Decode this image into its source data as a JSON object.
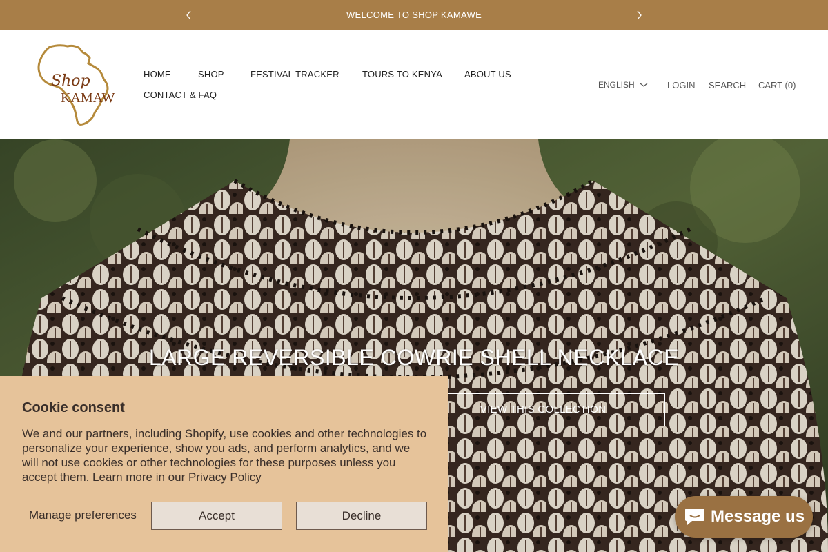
{
  "announcement": {
    "text": "WELCOME TO SHOP KAMAWE",
    "prev_icon": "chevron-left-icon",
    "next_icon": "chevron-right-icon"
  },
  "brand": {
    "logo_line1": "Shop",
    "logo_line2": "KAMAWE",
    "accent": "#a87e48"
  },
  "nav": {
    "items": [
      {
        "label": "HOME"
      },
      {
        "label": "SHOP"
      },
      {
        "label": "FESTIVAL TRACKER"
      },
      {
        "label": "TOURS TO KENYA"
      },
      {
        "label": "ABOUT US"
      },
      {
        "label": "CONTACT & FAQ"
      }
    ]
  },
  "header_right": {
    "language": "ENGLISH",
    "login": "LOGIN",
    "search": "SEARCH",
    "cart": "CART (0)"
  },
  "hero": {
    "title": "LARGE REVERSIBLE COWRIE SHELL NECKLACE",
    "button": "VIEW THIS COLLECTION"
  },
  "cookie": {
    "title": "Cookie consent",
    "body": "We and our partners, including Shopify, use cookies and other technologies to personalize your experience, show you ads, and perform analytics, and we will not use cookies or other technologies for these purposes unless you accept them. Learn more in our ",
    "policy_link": "Privacy Policy",
    "manage": "Manage preferences",
    "accept": "Accept",
    "decline": "Decline",
    "bg_color": "#e6c39a"
  },
  "chat": {
    "label": "Message us",
    "bg_color": "#9a7142"
  }
}
